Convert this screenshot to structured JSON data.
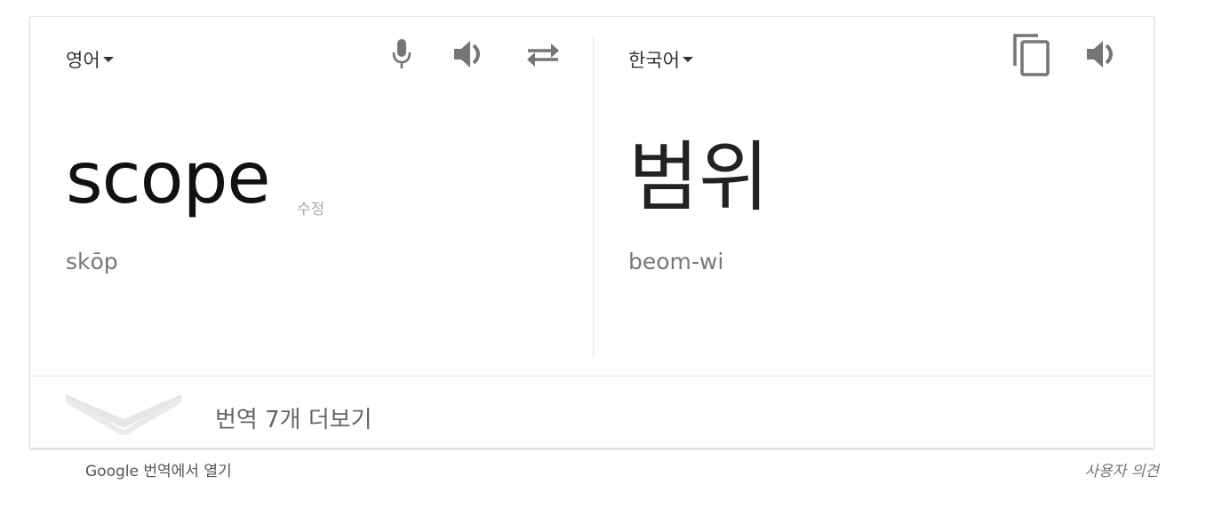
{
  "source": {
    "language": "영어",
    "text": "scope",
    "edit_label": "수정",
    "transliteration": "skōp"
  },
  "target": {
    "language": "한국어",
    "text": "범위",
    "transliteration": "beom-wi"
  },
  "more_translations_label": "번역 7개 더보기",
  "footer": {
    "open_in_translate": "Google 번역에서 열기",
    "feedback": "사용자 의견"
  },
  "icons": [
    "microphone-icon",
    "speaker-icon",
    "swap-icon",
    "copy-icon",
    "chevron-down-icon"
  ],
  "colors": {
    "text": "#222222",
    "secondary": "#777777",
    "icon": "#757575",
    "border": "#e4e4e4"
  }
}
